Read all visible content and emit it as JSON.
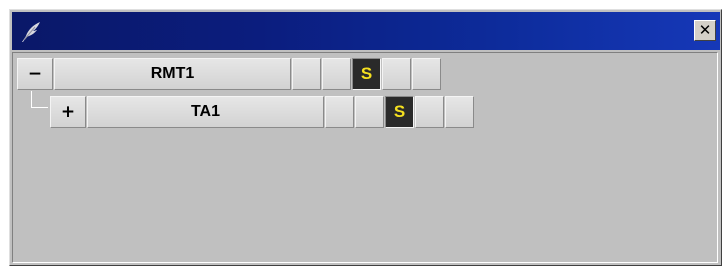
{
  "window": {
    "app_icon": "feather-icon",
    "close_label": "✕",
    "close_icon": "close-icon",
    "title_gradient": [
      "#0a1868",
      "#1638b8"
    ],
    "face_color": "#c0c0c0"
  },
  "tree": {
    "nodes": [
      {
        "toggle": "−",
        "name": "RMT1",
        "status": "S",
        "status_color": "#f5e020",
        "expanded": true
      },
      {
        "toggle": "+",
        "name": "TA1",
        "status": "S",
        "status_color": "#f5e020",
        "expanded": false
      }
    ]
  }
}
